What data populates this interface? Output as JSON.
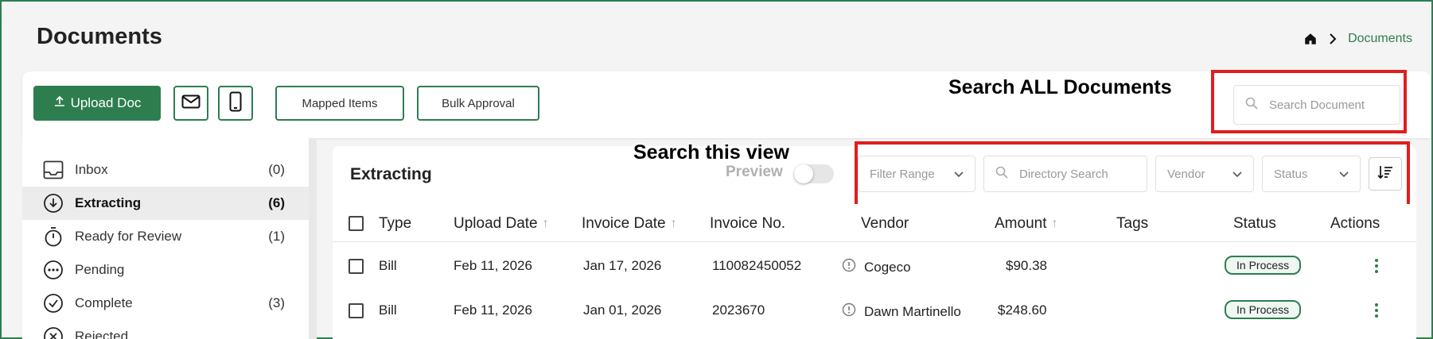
{
  "page": {
    "title": "Documents"
  },
  "breadcrumb": {
    "current": "Documents"
  },
  "toolbar": {
    "upload_label": "Upload Doc",
    "mapped_items_label": "Mapped Items",
    "bulk_approval_label": "Bulk Approval",
    "search_placeholder": "Search Document"
  },
  "annotations": {
    "search_all": "Search ALL Documents",
    "search_view": "Search this view"
  },
  "sidebar": {
    "items": [
      {
        "label": "Inbox",
        "count": "(0)",
        "icon": "inbox-icon"
      },
      {
        "label": "Extracting",
        "count": "(6)",
        "icon": "download-circle-icon",
        "active": true
      },
      {
        "label": "Ready for Review",
        "count": "(1)",
        "icon": "timer-icon"
      },
      {
        "label": "Pending",
        "count": "",
        "icon": "ellipsis-circle-icon"
      },
      {
        "label": "Complete",
        "count": "(3)",
        "icon": "check-circle-icon"
      },
      {
        "label": "Rejected",
        "count": "",
        "icon": "x-circle-icon"
      }
    ]
  },
  "panel": {
    "title": "Extracting",
    "preview_label": "Preview",
    "filters": {
      "range": "Filter Range",
      "directory": "Directory Search",
      "vendor": "Vendor",
      "status": "Status"
    }
  },
  "table": {
    "columns": [
      "Type",
      "Upload Date",
      "Invoice Date",
      "Invoice No.",
      "Vendor",
      "Amount",
      "Tags",
      "Status",
      "Actions"
    ],
    "rows": [
      {
        "type": "Bill",
        "upload_date": "Feb 11, 2026",
        "invoice_date": "Jan 17, 2026",
        "invoice_no": "110082450052",
        "vendor": "Cogeco",
        "amount": "$90.38",
        "tags": "",
        "status": "In Process"
      },
      {
        "type": "Bill",
        "upload_date": "Feb 11, 2026",
        "invoice_date": "Jan 01, 2026",
        "invoice_no": "2023670",
        "vendor": "Dawn Martinello",
        "amount": "$248.60",
        "tags": "",
        "status": "In Process"
      }
    ]
  },
  "colors": {
    "accent": "#2e7d4f",
    "annotation_red": "#e01e1e"
  }
}
